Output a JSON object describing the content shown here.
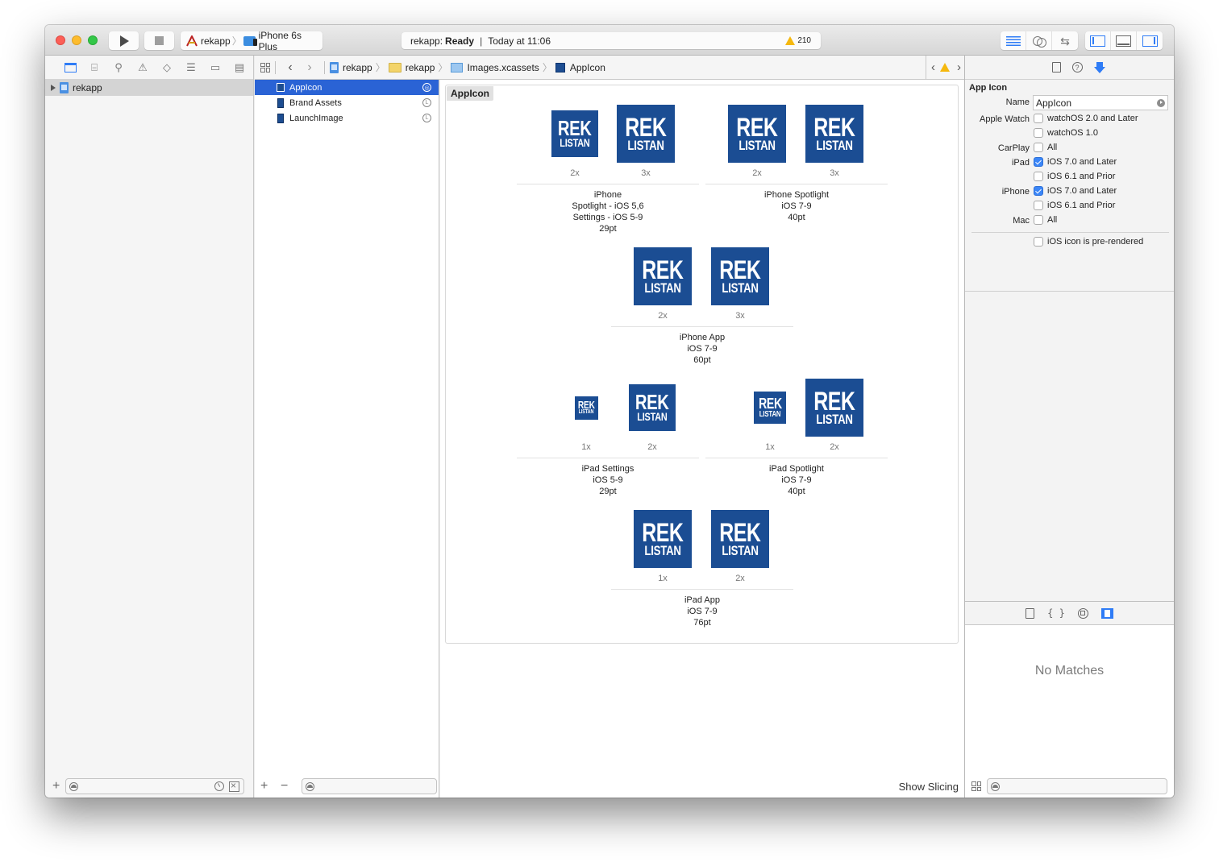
{
  "toolbar": {
    "scheme_app": "rekapp",
    "scheme_device": "iPhone 6s Plus",
    "activity_project": "rekapp:",
    "activity_status": "Ready",
    "activity_time": "Today at 11:06",
    "warning_count": "210"
  },
  "navigator": {
    "tabs": [
      "project-navigator",
      "symbol-navigator",
      "find-navigator",
      "issue-navigator",
      "test-navigator",
      "debug-navigator",
      "breakpoint-navigator",
      "report-navigator"
    ],
    "root_item": "rekapp"
  },
  "jumpbar": {
    "crumbs": [
      "rekapp",
      "rekapp",
      "Images.xcassets",
      "AppIcon"
    ]
  },
  "asset_list": {
    "items": [
      {
        "label": "AppIcon",
        "selected": true,
        "badge": "◎"
      },
      {
        "label": "Brand Assets",
        "selected": false,
        "badge": "L"
      },
      {
        "label": "LaunchImage",
        "selected": false,
        "badge": "L"
      }
    ]
  },
  "canvas": {
    "set_title": "AppIcon",
    "icon_text_line1": "REK",
    "icon_text_line2": "LISTAN",
    "icon_color": "#1b4d93",
    "groups": [
      {
        "scales": [
          "2x",
          "3x"
        ],
        "caption": [
          "iPhone",
          "Spotlight - iOS 5,6",
          "Settings - iOS 5-9",
          "29pt"
        ]
      },
      {
        "scales": [
          "2x",
          "3x"
        ],
        "caption": [
          "iPhone Spotlight",
          "iOS 7-9",
          "40pt"
        ]
      },
      {
        "scales": [
          "2x",
          "3x"
        ],
        "caption": [
          "iPhone App",
          "iOS 7-9",
          "60pt"
        ]
      },
      {
        "scales": [
          "1x",
          "2x"
        ],
        "caption": [
          "iPad Settings",
          "iOS 5-9",
          "29pt"
        ]
      },
      {
        "scales": [
          "1x",
          "2x"
        ],
        "caption": [
          "iPad Spotlight",
          "iOS 7-9",
          "40pt"
        ]
      },
      {
        "scales": [
          "1x",
          "2x"
        ],
        "caption": [
          "iPad App",
          "iOS 7-9",
          "76pt"
        ]
      }
    ],
    "show_slicing": "Show Slicing"
  },
  "inspector": {
    "section_title": "App Icon",
    "name_label": "Name",
    "name_value": "AppIcon",
    "rows": [
      {
        "label": "Apple Watch",
        "option": "watchOS 2.0 and Later",
        "checked": false
      },
      {
        "label": "",
        "option": "watchOS 1.0",
        "checked": false
      },
      {
        "label": "CarPlay",
        "option": "All",
        "checked": false
      },
      {
        "label": "iPad",
        "option": "iOS 7.0 and Later",
        "checked": true
      },
      {
        "label": "",
        "option": "iOS 6.1 and Prior",
        "checked": false
      },
      {
        "label": "iPhone",
        "option": "iOS 7.0 and Later",
        "checked": true
      },
      {
        "label": "",
        "option": "iOS 6.1 and Prior",
        "checked": false
      },
      {
        "label": "Mac",
        "option": "All",
        "checked": false
      }
    ],
    "prerendered_label": "iOS icon is pre-rendered",
    "prerendered_checked": false
  },
  "library": {
    "empty_text": "No Matches"
  },
  "colors": {
    "accent": "#2f7cf6",
    "selection": "#2a63d5",
    "warning": "#f5b80e"
  }
}
